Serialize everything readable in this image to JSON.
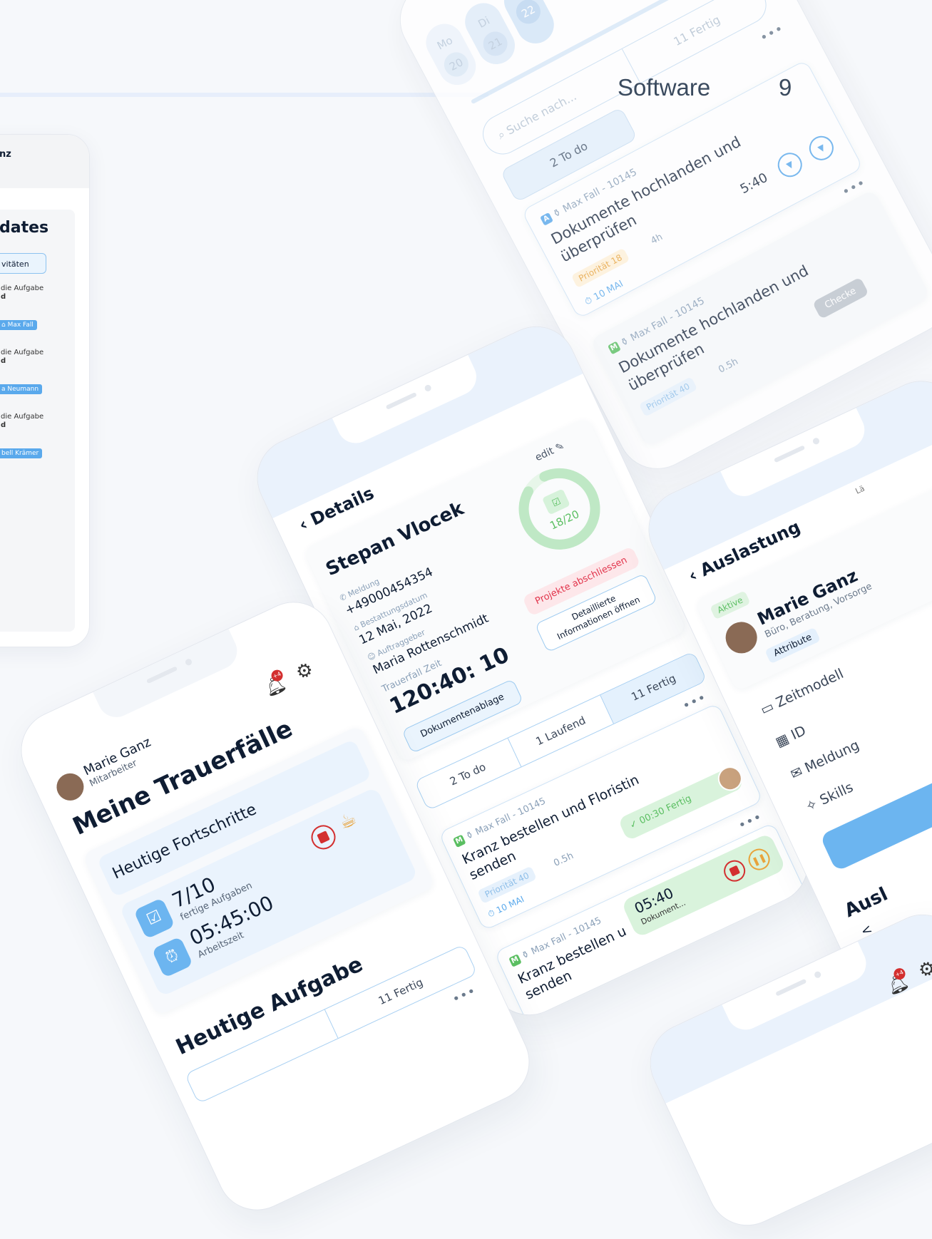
{
  "caption": "Software",
  "page_number": "9",
  "tablet": {
    "name": "nz",
    "title": "dates",
    "tab": "vitäten",
    "lines": [
      "die Aufgabe",
      "d",
      "die Aufgabe",
      "d",
      "die Aufgabe",
      "d"
    ],
    "chips": [
      "Max Fall",
      "a Neumann",
      "bell Krämer"
    ]
  },
  "top_phone": {
    "days": [
      {
        "d": "Mo",
        "n": "20"
      },
      {
        "d": "Di",
        "n": "21"
      },
      {
        "d": "",
        "n": "22"
      }
    ],
    "search_placeholder": "Suche nach...",
    "tabs": [
      "2 To do",
      "11 Fertig"
    ],
    "task1": {
      "badge": "A",
      "case": "Max Fall - 10145",
      "title1": "Dokumente hochlanden und",
      "title2": "überprüfen",
      "prio": "Priorität 18",
      "hours": "4h",
      "time": "5:40",
      "date": "10 MAI"
    },
    "task2": {
      "badge": "M",
      "case": "Max Fall - 10145",
      "title1": "Dokumente hochlanden und",
      "title2": "überprüfen",
      "prio": "Priorität 40",
      "hours": "0.5h",
      "status": "Checke"
    }
  },
  "details_phone": {
    "back": "Details",
    "edit": "edit",
    "name": "Stepan Vlocek",
    "meldung_label": "Meldung",
    "phone": "+4900045435​4",
    "date_label": "Bestattungsdatum",
    "date": "12 Mai, 2022",
    "client_label": "Auftraggeber",
    "client": "Maria Rottenschmidt",
    "time_label": "Trauerfall Zeit",
    "time": "120:40: 10",
    "progress_text": "18/20",
    "progress": 0.9,
    "close_btn": "Projekte abschliessen",
    "detail_btn_1": "Detaillierte",
    "detail_btn_2": "Informationen öffnen",
    "docs_btn": "Dokumentenablage",
    "tabs": [
      "2 To do",
      "1 Laufend",
      "11 Fertig"
    ],
    "task1": {
      "badge": "M",
      "case": "Max Fall - 10145",
      "title1": "Kranz bestellen und Floristin",
      "title2": "senden",
      "prio": "Priorität 40",
      "hours": "0.5h",
      "done": "00:30 Fertig",
      "date": "10 MAI"
    },
    "task2": {
      "badge": "M",
      "case": "Max Fall - 10145",
      "title1": "Kranz bestellen u",
      "title2": "senden",
      "timer": "05:40",
      "timer_label": "Dokument..."
    }
  },
  "home_phone": {
    "user": "Marie Ganz",
    "role": "Mitarbeiter",
    "notif": "+4",
    "title": "Meine Trauerfälle",
    "progress_title": "Heutige Fortschritte",
    "tasks_done": "7/10",
    "tasks_label": "fertige Aufgaben",
    "work_time": "05:45:00",
    "work_label": "Arbeitszeit",
    "section": "Heutige Aufgabe",
    "tab": "11 Fertig"
  },
  "right_phone": {
    "back": "Auslastung",
    "corner_top": "Lä",
    "status": "Aktive",
    "name": "Marie Ganz",
    "sub": "Büro, Beratung, Vorsorge",
    "attr": "Attribute",
    "items": [
      "Zeitmodell",
      "ID",
      "Meldung",
      "Skills"
    ],
    "section": "Ausl",
    "back_sub": "<"
  },
  "bottom_phone": {
    "notif": "+4"
  },
  "colors": {
    "accent": "#5aa9ec",
    "green": "#5bbf62",
    "red": "#d32f2f",
    "orange": "#e8a33b",
    "light": "#eaf3fd"
  }
}
